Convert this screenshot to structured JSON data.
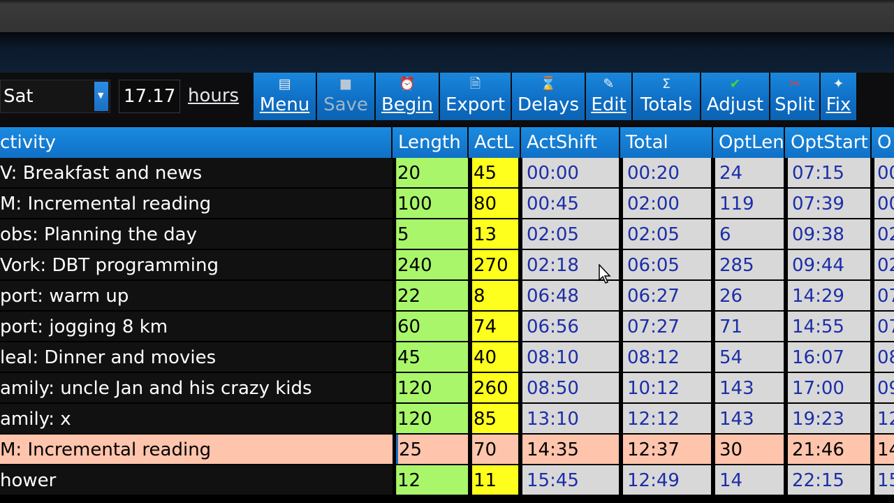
{
  "toolbar": {
    "day": "Sat",
    "hours_value": "17.17",
    "hours_label": "hours",
    "buttons": [
      {
        "id": "menu",
        "icon": "menu-icon",
        "label": "Menu",
        "disabled": false
      },
      {
        "id": "save",
        "icon": "save-icon",
        "label": "Save",
        "disabled": true
      },
      {
        "id": "begin",
        "icon": "alarm-clock-icon",
        "label": "Begin",
        "disabled": false
      },
      {
        "id": "export",
        "icon": "export-document-icon",
        "label": "Export",
        "disabled": false
      },
      {
        "id": "delays",
        "icon": "hourglass-icon",
        "label": "Delays",
        "disabled": false
      },
      {
        "id": "edit",
        "icon": "edit-pencil-icon",
        "label": "Edit",
        "disabled": false
      },
      {
        "id": "totals",
        "icon": "sigma-icon",
        "label": "Totals",
        "disabled": false
      },
      {
        "id": "adjust",
        "icon": "checkmark-icon",
        "label": "Adjust",
        "disabled": false
      },
      {
        "id": "split",
        "icon": "scissors-icon",
        "label": "Split",
        "disabled": false
      },
      {
        "id": "fix",
        "icon": "pin-icon",
        "label": "Fix",
        "disabled": false
      }
    ]
  },
  "columns": [
    "ctivity",
    "Length",
    "ActL",
    "ActShift",
    "Total",
    "OptLen",
    "OptStart",
    "O"
  ],
  "rows": [
    {
      "activity": "V: Breakfast and news",
      "length": "20",
      "actlen": "45",
      "actshift": "00:00",
      "total": "00:20",
      "optlen": "24",
      "optstart": "07:15",
      "extra": "00",
      "highlight": false
    },
    {
      "activity": "M: Incremental reading",
      "length": "100",
      "actlen": "80",
      "actshift": "00:45",
      "total": "02:00",
      "optlen": "119",
      "optstart": "07:39",
      "extra": "00",
      "highlight": false
    },
    {
      "activity": "obs: Planning the day",
      "length": "5",
      "actlen": "13",
      "actshift": "02:05",
      "total": "02:05",
      "optlen": "6",
      "optstart": "09:38",
      "extra": "02",
      "highlight": false
    },
    {
      "activity": "Vork: DBT programming",
      "length": "240",
      "actlen": "270",
      "actshift": "02:18",
      "total": "06:05",
      "optlen": "285",
      "optstart": "09:44",
      "extra": "02",
      "highlight": false
    },
    {
      "activity": "port: warm up",
      "length": "22",
      "actlen": "8",
      "actshift": "06:48",
      "total": "06:27",
      "optlen": "26",
      "optstart": "14:29",
      "extra": "07",
      "highlight": false
    },
    {
      "activity": "port: jogging 8 km",
      "length": "60",
      "actlen": "74",
      "actshift": "06:56",
      "total": "07:27",
      "optlen": "71",
      "optstart": "14:55",
      "extra": "07",
      "highlight": false
    },
    {
      "activity": "leal: Dinner and movies",
      "length": "45",
      "actlen": "40",
      "actshift": "08:10",
      "total": "08:12",
      "optlen": "54",
      "optstart": "16:07",
      "extra": "08",
      "highlight": false
    },
    {
      "activity": "amily: uncle Jan and his crazy kids",
      "length": "120",
      "actlen": "260",
      "actshift": "08:50",
      "total": "10:12",
      "optlen": "143",
      "optstart": "17:00",
      "extra": "09",
      "highlight": false
    },
    {
      "activity": "amily: x",
      "length": "120",
      "actlen": "85",
      "actshift": "13:10",
      "total": "12:12",
      "optlen": "143",
      "optstart": "19:23",
      "extra": "12",
      "highlight": false
    },
    {
      "activity": "M: Incremental reading",
      "length": "25",
      "actlen": "70",
      "actshift": "14:35",
      "total": "12:37",
      "optlen": "30",
      "optstart": "21:46",
      "extra": "14",
      "highlight": true
    },
    {
      "activity": "hower",
      "length": "12",
      "actlen": "11",
      "actshift": "15:45",
      "total": "12:49",
      "optlen": "14",
      "optstart": "22:15",
      "extra": "15",
      "highlight": false
    }
  ],
  "colors": {
    "toolbar_blue": "#1178cf",
    "length_green": "#a9f66b",
    "actlen_yellow": "#ffff1e",
    "time_cell_gray": "#d8d8d8",
    "time_text_blue": "#1c2ea8",
    "highlight_row": "#ffc4ac"
  }
}
